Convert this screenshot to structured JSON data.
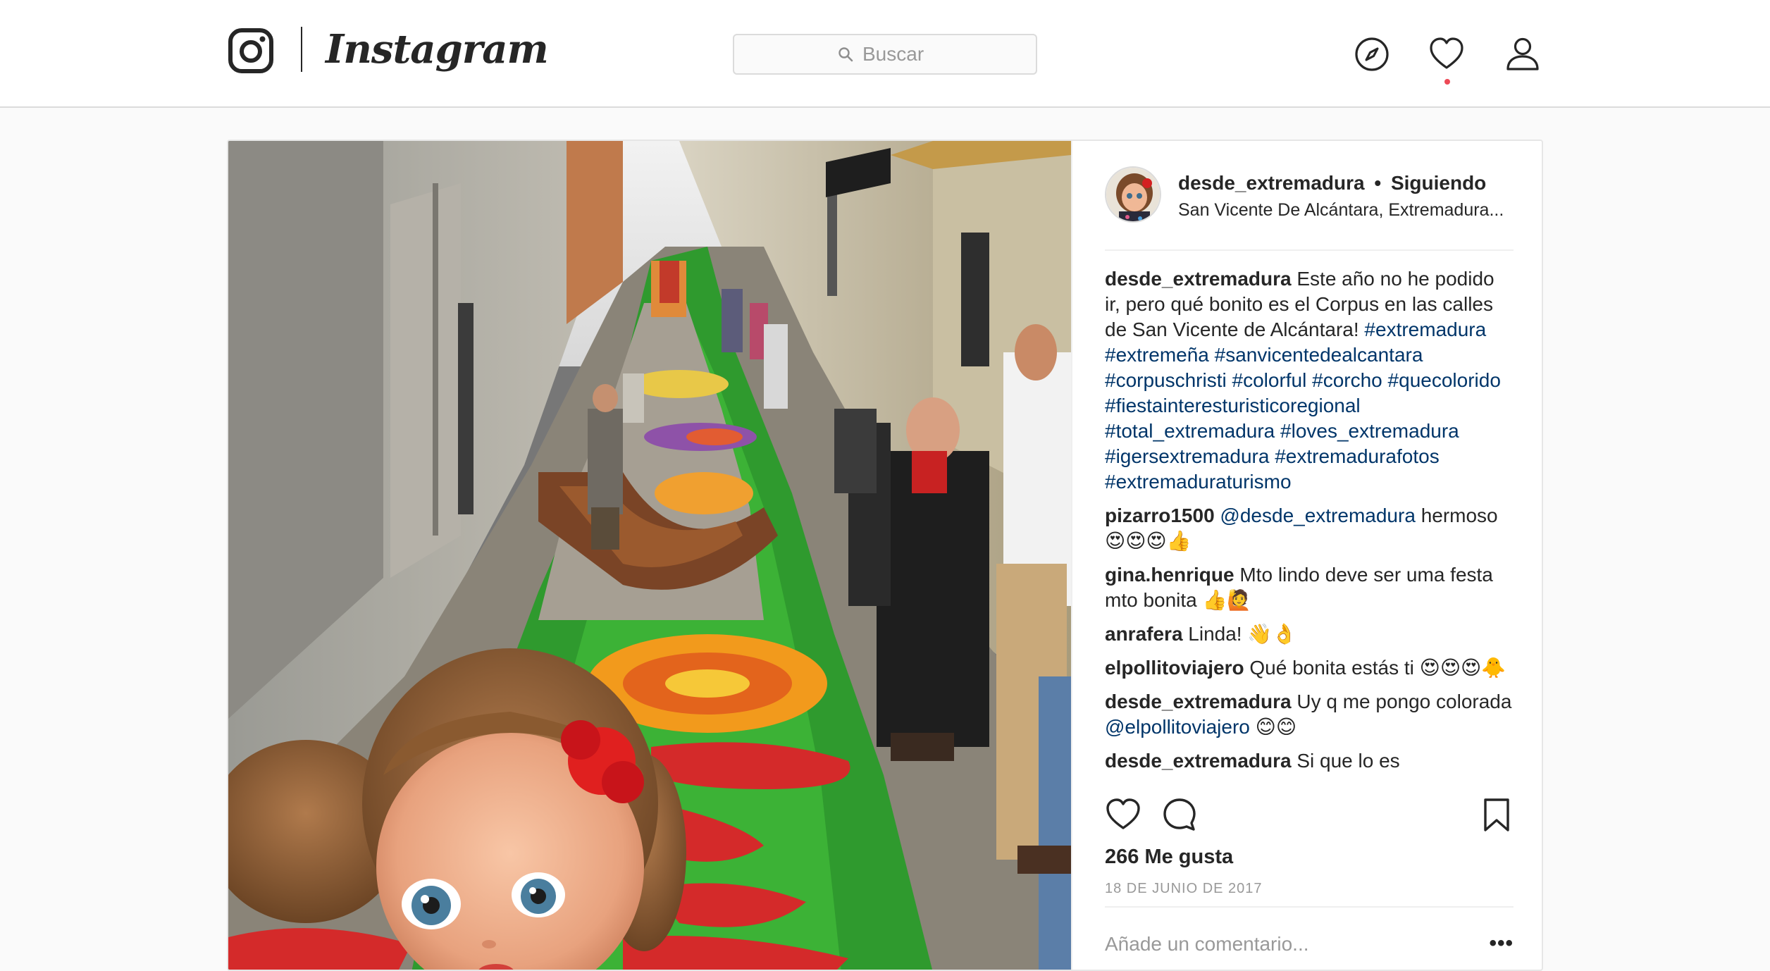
{
  "header": {
    "brand": "Instagram",
    "search": {
      "placeholder": "Buscar",
      "value": ""
    },
    "nav_icons": [
      "compass-icon",
      "heart-icon",
      "profile-icon"
    ],
    "has_notification": true
  },
  "post": {
    "author": "desde_extremadura",
    "follow_status": "Siguiendo",
    "separator": "•",
    "location": "San Vicente De Alcántara, Extremadura...",
    "caption": {
      "user": "desde_extremadura",
      "text": "Este año no he podido ir, pero qué bonito es el Corpus en las calles de San Vicente de Alcántara!",
      "hashtags": [
        "#extremadura",
        "#extremeña",
        "#sanvicentedealcantara",
        "#corpuschristi",
        "#colorful",
        "#corcho",
        "#quecolorido",
        "#fiestainteresturisticoregional",
        "#total_extremadura",
        "#loves_extremadura",
        "#igersextremadura",
        "#extremadurafotos",
        "#extremaduraturismo"
      ]
    },
    "comments": [
      {
        "user": "pizarro1500",
        "mention": "@desde_extremadura",
        "text": "hermoso 😍😍😍👍"
      },
      {
        "user": "gina.henrique",
        "mention": "",
        "text": "Mto lindo deve ser uma festa mto bonita 👍🙋"
      },
      {
        "user": "anrafera",
        "mention": "",
        "text": "Linda! 👋👌"
      },
      {
        "user": "elpollitoviajero",
        "mention": "",
        "text": "Qué bonita estás ti 😍😍😍🐥"
      },
      {
        "user": "desde_extremadura",
        "text_before": "Uy q me pongo colorada",
        "mention": "@elpollitoviajero",
        "text": "😊😊"
      },
      {
        "user": "desde_extremadura",
        "mention": "",
        "text": "Si que lo es"
      }
    ],
    "likes_label": "266 Me gusta",
    "date": "18 DE JUNIO DE 2017",
    "add_comment_placeholder": "Añade un comentario...",
    "more_label": "•••",
    "colors": {
      "link": "#003569",
      "text": "#262626",
      "muted": "#999999",
      "notification": "#ed4956"
    }
  }
}
